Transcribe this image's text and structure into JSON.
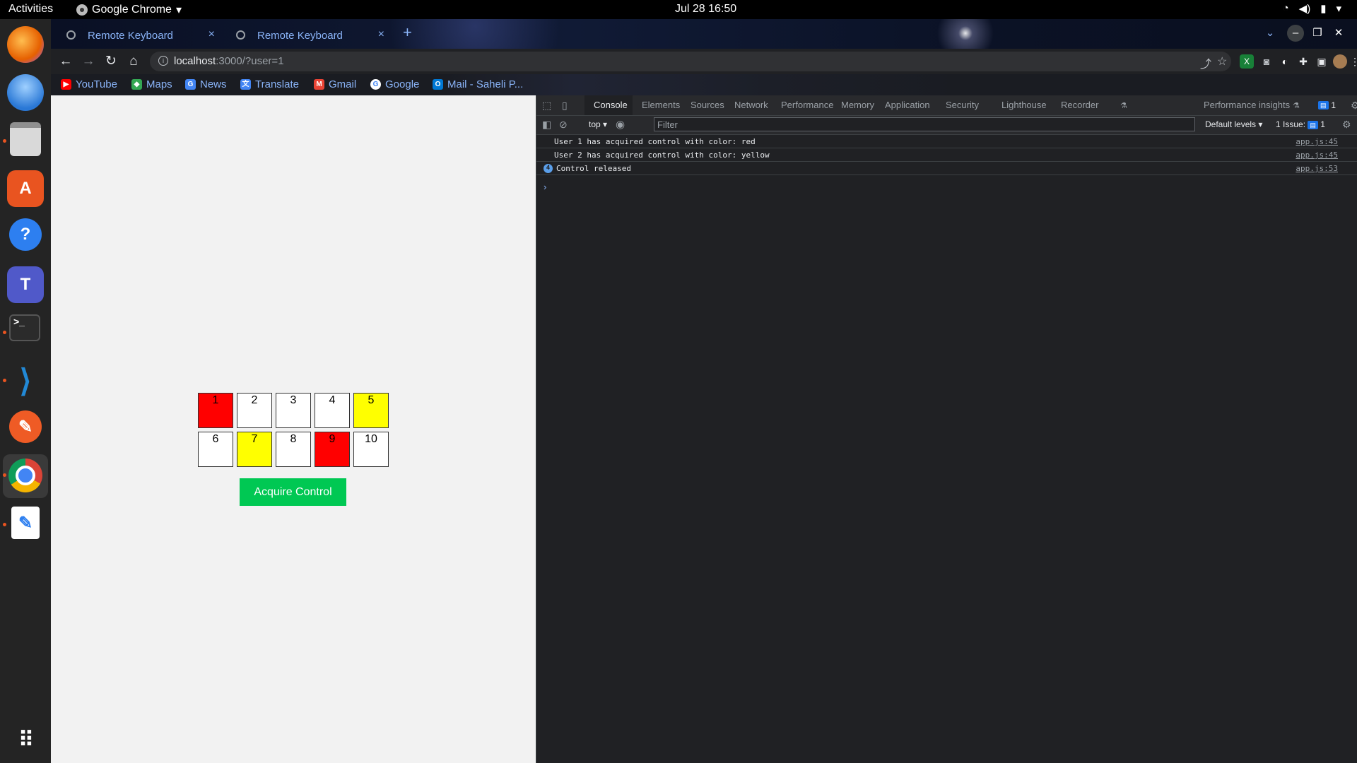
{
  "system": {
    "activities": "Activities",
    "app_menu": "Google Chrome",
    "clock": "Jul 28  16:50",
    "tray": [
      "wifi-icon",
      "volume-icon",
      "battery-icon",
      "power-icon"
    ]
  },
  "dock": {
    "items": [
      {
        "name": "firefox",
        "color": "#e66000"
      },
      {
        "name": "thunderbird",
        "color": "#2a78d6"
      },
      {
        "name": "files",
        "color": "#c9c9c9"
      },
      {
        "name": "software",
        "color": "#e95420"
      },
      {
        "name": "help",
        "color": "#2d7ff0"
      },
      {
        "name": "teams",
        "color": "#5059c9"
      },
      {
        "name": "terminal",
        "color": "#3a3a3a"
      },
      {
        "name": "vscode",
        "color": "#2289d6"
      },
      {
        "name": "postman",
        "color": "#ef5b25"
      },
      {
        "name": "chrome",
        "color": "#db4437"
      },
      {
        "name": "text-editor",
        "color": "#ffffff"
      }
    ],
    "show_apps": "show-apps-icon"
  },
  "browser": {
    "tabs": [
      {
        "title": "Remote Keyboard",
        "close": "×"
      },
      {
        "title": "Remote Keyboard",
        "close": "×"
      }
    ],
    "new_tab": "+",
    "url_host": "localhost",
    "url_rest": ":3000/?user=1",
    "bookmarks": [
      {
        "label": "YouTube",
        "color": "#ff0000"
      },
      {
        "label": "Maps",
        "color": "#34a853"
      },
      {
        "label": "News",
        "color": "#4285f4"
      },
      {
        "label": "Translate",
        "color": "#4285f4"
      },
      {
        "label": "Gmail",
        "color": "#ea4335"
      },
      {
        "label": "Google",
        "color": "#ffffff"
      },
      {
        "label": "Mail - Saheli P...",
        "color": "#0078d4"
      }
    ]
  },
  "app": {
    "keys": [
      {
        "label": "1",
        "color": "#ff0000"
      },
      {
        "label": "2",
        "color": "#ffffff"
      },
      {
        "label": "3",
        "color": "#ffffff"
      },
      {
        "label": "4",
        "color": "#ffffff"
      },
      {
        "label": "5",
        "color": "#ffff00"
      },
      {
        "label": "6",
        "color": "#ffffff"
      },
      {
        "label": "7",
        "color": "#ffff00"
      },
      {
        "label": "8",
        "color": "#ffffff"
      },
      {
        "label": "9",
        "color": "#ff0000"
      },
      {
        "label": "10",
        "color": "#ffffff"
      }
    ],
    "acquire_button": "Acquire Control",
    "button_color": "#00c853"
  },
  "devtools": {
    "tabs": [
      "Console",
      "Elements",
      "Sources",
      "Network",
      "Performance",
      "Memory",
      "Application",
      "Security",
      "Lighthouse",
      "Recorder",
      "Performance insights"
    ],
    "active_tab": "Console",
    "issues_badge": "1",
    "context": "top",
    "filter_placeholder": "Filter",
    "levels": "Default levels",
    "issues": "1 Issue:",
    "issues_count": "1",
    "logs": [
      {
        "message": "User 1 has acquired control with color: red",
        "source": "app.js:45",
        "count": ""
      },
      {
        "message": "User 2 has acquired control with color: yellow",
        "source": "app.js:45",
        "count": ""
      },
      {
        "message": "Control released",
        "source": "app.js:53",
        "count": "4"
      }
    ],
    "prompt": "›"
  }
}
